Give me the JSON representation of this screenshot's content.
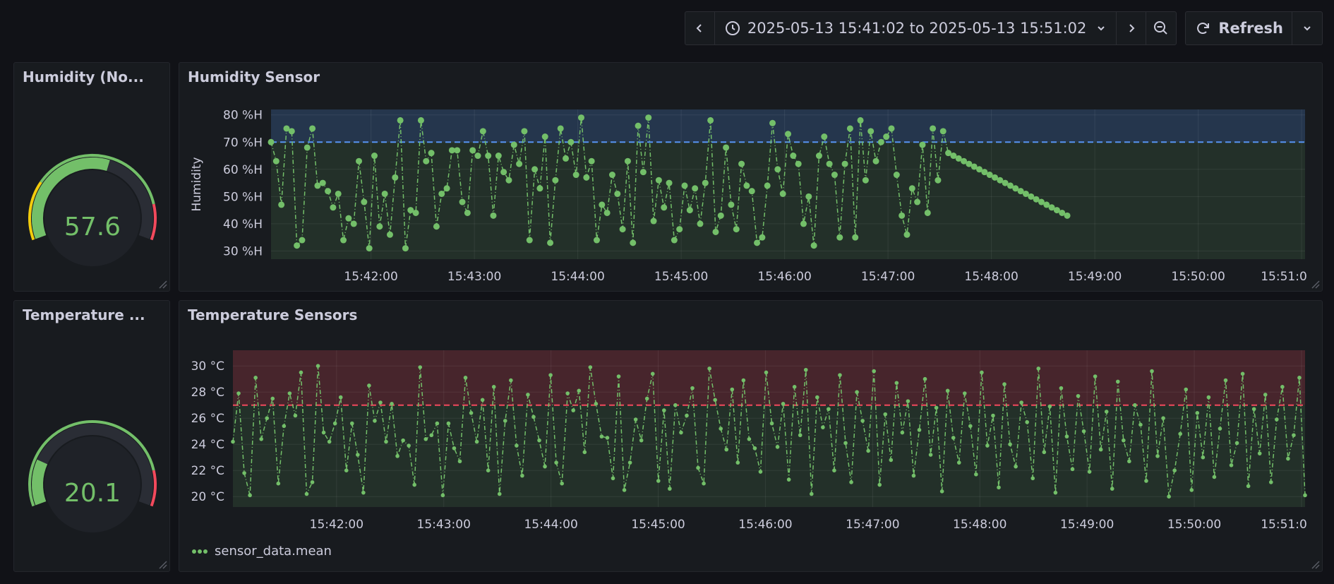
{
  "toolbar": {
    "time_range": "2025-05-13 15:41:02 to 2025-05-13 15:51:02",
    "refresh_label": "Refresh"
  },
  "colors": {
    "series": "#73bf69",
    "threshold_blue": "#5794f2",
    "threshold_red": "#f2495c",
    "gauge_yellow": "#fade2a",
    "gauge_orange": "#f2cc0c"
  },
  "humidity_gauge": {
    "title": "Humidity (No...",
    "value": "57.6",
    "value_num": 57.6,
    "min": 0,
    "max": 100
  },
  "temperature_gauge": {
    "title": "Temperature ...",
    "value": "20.1",
    "value_num": 20.1,
    "min": 0,
    "max": 100
  },
  "humidity_chart": {
    "title": "Humidity Sensor",
    "ylabel": "Humidity",
    "y_ticks": [
      "30 %H",
      "40 %H",
      "50 %H",
      "60 %H",
      "70 %H",
      "80 %H"
    ],
    "x_ticks": [
      "15:42:00",
      "15:43:00",
      "15:44:00",
      "15:45:00",
      "15:46:00",
      "15:47:00",
      "15:48:00",
      "15:49:00",
      "15:50:00",
      "15:51:0"
    ]
  },
  "temperature_chart": {
    "title": "Temperature Sensors",
    "y_ticks": [
      "20 °C",
      "22 °C",
      "24 °C",
      "26 °C",
      "28 °C",
      "30 °C"
    ],
    "x_ticks": [
      "15:42:00",
      "15:43:00",
      "15:44:00",
      "15:45:00",
      "15:46:00",
      "15:47:00",
      "15:48:00",
      "15:49:00",
      "15:50:00",
      "15:51:0"
    ],
    "legend": "sensor_data.mean"
  },
  "chart_data": [
    {
      "type": "line",
      "title": "Humidity Sensor",
      "ylabel": "Humidity",
      "xlabel": "",
      "x_range": [
        "15:41:02",
        "15:51:02"
      ],
      "ylim": [
        27,
        82
      ],
      "threshold": 70,
      "grid": true,
      "series": [
        {
          "x_seconds_from_start": [
            0,
            3,
            6,
            9,
            12,
            15,
            18,
            21,
            24,
            27,
            30,
            33,
            36,
            39,
            42,
            45,
            48,
            51,
            54,
            57,
            60,
            63,
            66,
            69,
            72,
            75,
            78,
            81,
            84,
            87,
            90,
            93,
            96,
            99,
            102,
            105,
            108,
            111,
            114,
            117,
            120,
            123,
            126,
            129,
            132,
            135,
            138,
            141,
            144,
            147,
            150,
            153,
            156,
            159,
            162,
            165,
            168,
            171,
            174,
            177,
            180,
            183,
            186,
            189,
            192,
            195,
            198,
            201,
            204,
            207,
            210,
            213,
            216,
            219,
            222,
            225,
            228,
            231,
            234,
            237,
            240,
            243,
            246,
            249,
            252,
            255,
            258,
            261,
            264,
            267,
            270,
            273,
            276,
            279,
            282,
            285,
            288,
            291,
            294,
            297,
            300,
            303,
            306,
            309,
            312,
            315,
            318,
            321,
            324,
            327,
            330,
            333,
            336,
            339,
            342,
            345,
            348,
            351,
            354,
            357,
            360,
            363,
            366,
            369,
            372,
            375,
            378,
            381,
            384,
            387,
            390,
            393,
            396,
            399,
            402,
            405,
            408,
            411,
            414,
            417,
            420,
            423,
            426,
            429,
            432,
            435,
            438,
            441,
            444,
            447,
            450,
            453,
            456,
            459,
            462,
            465
          ],
          "values": [
            70,
            63,
            47,
            75,
            74,
            32,
            34,
            68,
            75,
            54,
            55,
            52,
            46,
            51,
            34,
            42,
            40,
            63,
            48,
            31,
            65,
            39,
            51,
            36,
            57,
            78,
            31,
            45,
            44,
            78,
            63,
            66,
            39,
            51,
            53,
            67,
            67,
            48,
            44,
            67,
            65,
            74,
            65,
            43,
            65,
            59,
            56,
            69,
            62,
            74,
            34,
            60,
            53,
            72,
            33,
            56,
            75,
            64,
            70,
            58,
            79,
            57,
            63,
            34,
            47,
            44,
            58,
            51,
            38,
            63,
            33,
            76,
            59,
            79,
            41,
            56,
            46,
            55,
            34,
            38,
            54,
            45,
            53,
            40,
            55,
            78,
            37,
            43,
            68,
            47,
            38,
            62,
            54,
            52,
            33,
            35,
            54,
            77,
            60,
            51,
            73,
            65,
            62,
            40,
            50,
            32,
            65,
            72,
            62,
            58,
            35,
            62,
            75,
            35,
            78,
            56,
            74,
            63,
            70,
            72,
            75,
            58,
            43,
            36,
            53,
            48,
            69,
            44,
            75,
            56,
            74,
            66,
            65,
            64,
            63,
            62,
            61,
            60,
            59,
            58,
            57,
            56,
            55,
            54,
            53,
            52,
            51,
            50,
            49,
            48,
            47,
            46,
            45,
            44,
            43
          ]
        }
      ]
    },
    {
      "type": "line",
      "title": "Temperature Sensors",
      "xlabel": "",
      "ylabel": "",
      "x_range": [
        "15:41:02",
        "15:51:02"
      ],
      "ylim": [
        19.2,
        31.2
      ],
      "threshold": 27,
      "grid": true,
      "series": [
        {
          "name": "sensor_data.mean",
          "values": [
            24.2,
            27.9,
            21.8,
            20.1,
            29.1,
            24.4,
            26.0,
            27.5,
            21.0,
            25.4,
            27.9,
            26.2,
            29.5,
            20.2,
            21.1,
            30.0,
            24.9,
            24.2,
            25.6,
            27.6,
            22.0,
            25.6,
            23.2,
            20.3,
            28.5,
            25.8,
            27.2,
            24.2,
            27.1,
            23.1,
            24.3,
            23.9,
            20.9,
            29.9,
            24.4,
            24.7,
            25.6,
            20.1,
            25.6,
            23.7,
            22.7,
            29.1,
            26.4,
            24.2,
            27.4,
            22.0,
            28.4,
            20.2,
            25.8,
            28.9,
            23.9,
            21.6,
            27.8,
            26.1,
            24.3,
            22.3,
            29.3,
            22.6,
            21.0,
            27.9,
            26.6,
            28.1,
            23.4,
            29.9,
            27.1,
            24.6,
            24.5,
            21.4,
            29.2,
            20.5,
            22.6,
            25.9,
            24.3,
            27.5,
            29.4,
            21.2,
            26.6,
            20.6,
            27.0,
            24.9,
            26.2,
            28.3,
            22.2,
            21.0,
            29.8,
            27.4,
            25.2,
            23.6,
            28.2,
            22.6,
            28.9,
            24.4,
            23.7,
            21.9,
            29.5,
            25.6,
            23.8,
            27.1,
            21.3,
            28.4,
            24.7,
            29.7,
            20.2,
            27.6,
            25.3,
            26.7,
            22.0,
            29.3,
            24.1,
            21.1,
            28.0,
            25.8,
            23.5,
            29.6,
            20.9,
            26.3,
            22.8,
            28.7,
            24.9,
            27.3,
            21.6,
            25.1,
            29.0,
            23.2,
            26.8,
            20.4,
            28.1,
            24.5,
            22.6,
            27.9,
            25.4,
            21.7,
            29.5,
            23.9,
            26.2,
            20.7,
            28.6,
            24.0,
            22.3,
            27.2,
            25.7,
            21.4,
            29.8,
            23.4,
            26.9,
            20.3,
            28.3,
            24.6,
            22.1,
            27.7,
            25.0,
            21.9,
            29.2,
            23.6,
            26.5,
            20.6,
            28.8,
            24.3,
            22.7,
            27.0,
            25.5,
            21.2,
            29.6,
            23.1,
            26.0,
            20.0,
            22.0,
            24.8,
            28.2,
            20.5,
            26.4,
            23.0,
            27.6,
            21.5,
            25.2,
            28.9,
            22.4,
            24.1,
            29.4,
            20.8,
            26.7,
            23.3,
            27.8,
            21.1,
            25.9,
            28.4,
            22.9,
            24.7,
            29.1,
            20.1
          ]
        }
      ]
    },
    {
      "type": "gauge",
      "title": "Humidity (No...",
      "value": 57.6,
      "min": 0,
      "max": 100
    },
    {
      "type": "gauge",
      "title": "Temperature ...",
      "value": 20.1,
      "min": 0,
      "max": 100
    }
  ]
}
